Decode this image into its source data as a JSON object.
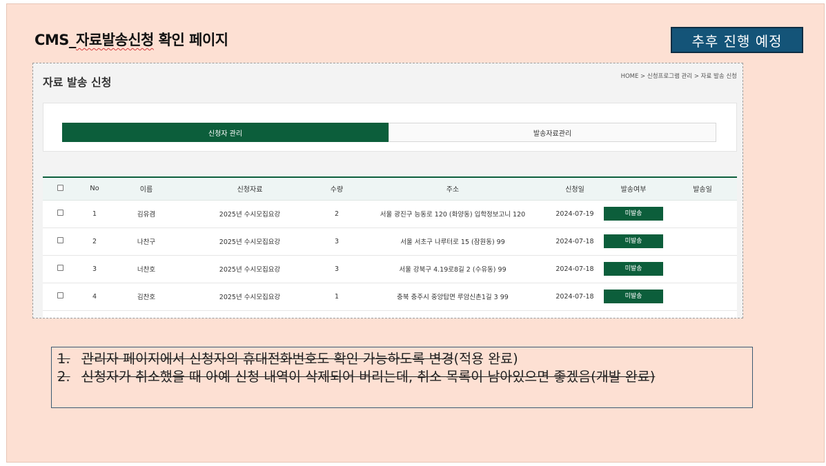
{
  "slide": {
    "title_prefix": "CMS_",
    "title_underlined": "자료발송신청",
    "title_suffix": " 확인 페이지",
    "badge": "추후 진행 예정"
  },
  "screen": {
    "title": "자료 발송 신청",
    "breadcrumb": "HOME > 신청프로그램 관리 > 자료 발송 신청",
    "tabs": [
      {
        "label": "신청자 관리",
        "active": true
      },
      {
        "label": "발송자료관리",
        "active": false
      }
    ],
    "table": {
      "headers": [
        "No",
        "이름",
        "신청자료",
        "수량",
        "주소",
        "신청일",
        "발송여부",
        "발송일"
      ],
      "rows": [
        {
          "no": "1",
          "name": "김유겸",
          "material": "2025년 수시모집요강",
          "qty": "2",
          "address": "서울 광진구 능동로 120 (화양동) 입학정보고니 120",
          "date": "2024-07-19",
          "status": "미발송",
          "sent_date": ""
        },
        {
          "no": "2",
          "name": "나찬구",
          "material": "2025년 수시모집요강",
          "qty": "3",
          "address": "서울 서초구 나루터로 15 (잠원동) 99",
          "date": "2024-07-18",
          "status": "미발송",
          "sent_date": ""
        },
        {
          "no": "3",
          "name": "너찬호",
          "material": "2025년 수시모집요강",
          "qty": "3",
          "address": "서울 강북구 4.19로8길 2 (수유동) 99",
          "date": "2024-07-18",
          "status": "미발송",
          "sent_date": ""
        },
        {
          "no": "4",
          "name": "김찬호",
          "material": "2025년 수시모집요강",
          "qty": "1",
          "address": "충북 충주시 중앙탑면 루암신촌1길 3 99",
          "date": "2024-07-18",
          "status": "미발송",
          "sent_date": ""
        }
      ]
    }
  },
  "notes": [
    {
      "num": "1.",
      "struck": "관리자 페이지에서 신청자의 휴대전화번호도 확인 가능하도록 변경",
      "plain": "(적용 완료)"
    },
    {
      "num": "2.",
      "struck": "신청자가 취소했을 때 아예 신청 내역이 삭제되어 버리는데, 취소 목록이 남아있으면 좋겠음(개발 완료)",
      "plain": ""
    }
  ]
}
